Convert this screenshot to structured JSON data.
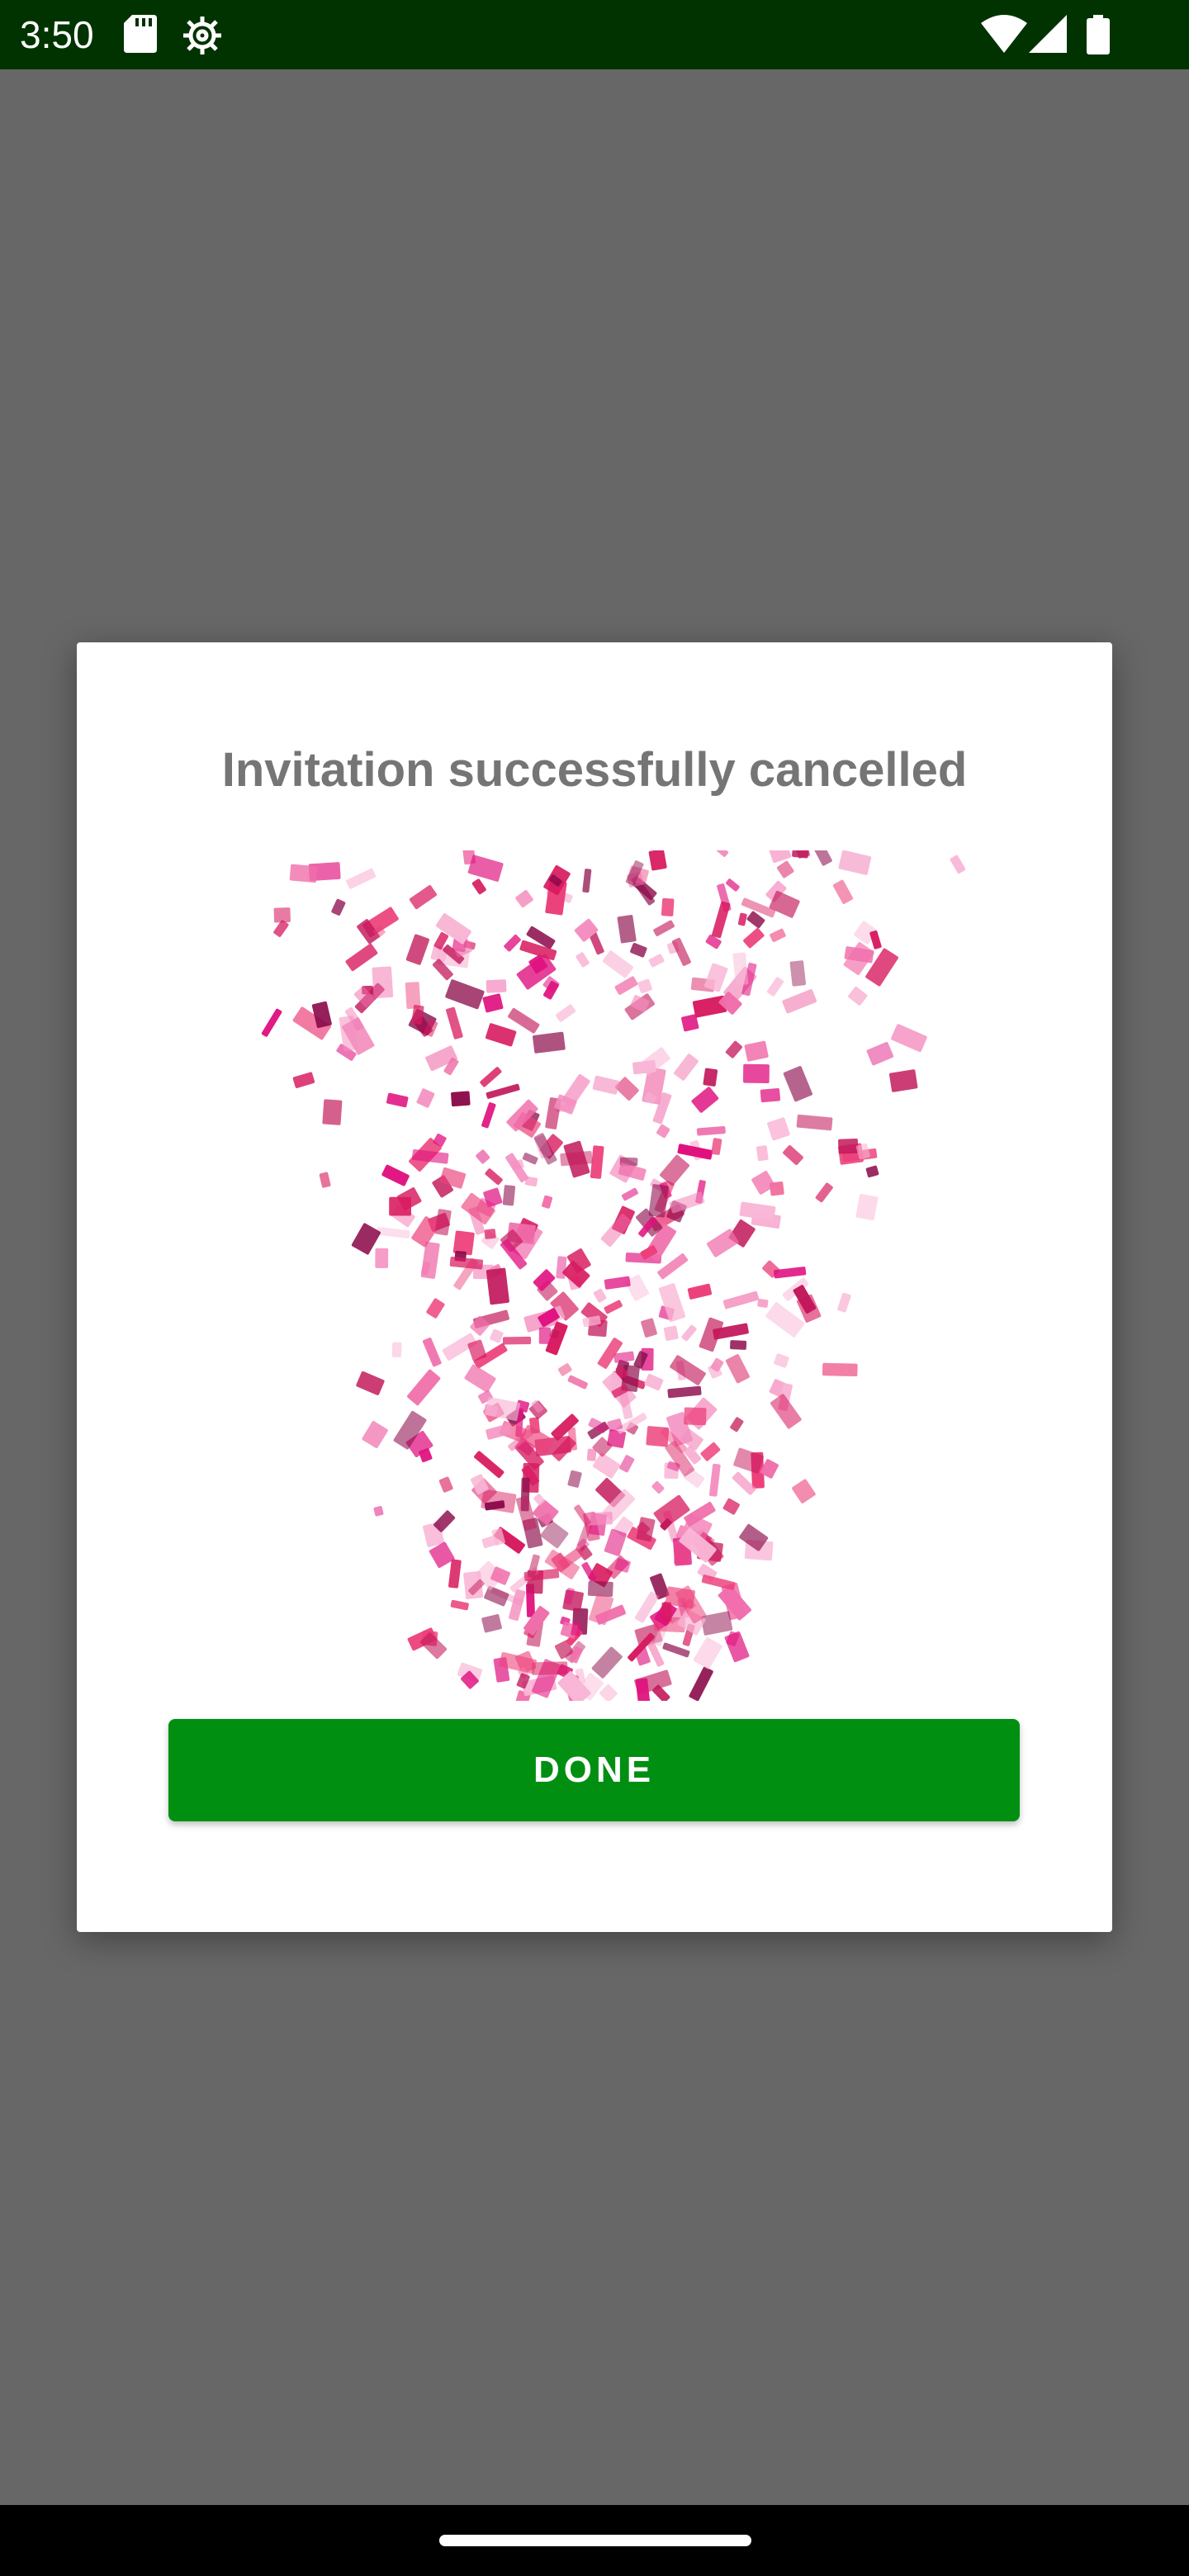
{
  "status_bar": {
    "time": "3:50",
    "icons": [
      "sd-card-icon",
      "settings-icon",
      "wifi-icon",
      "signal-icon",
      "battery-icon"
    ]
  },
  "dialog": {
    "title": "Invitation successfully cancelled",
    "image": "confetti-animation",
    "done_label": "DONE"
  },
  "colors": {
    "status_bar_bg": "#003300",
    "scrim": "#676767",
    "button": "#008f11",
    "title_text": "#757575",
    "confetti": "#e0117f"
  }
}
